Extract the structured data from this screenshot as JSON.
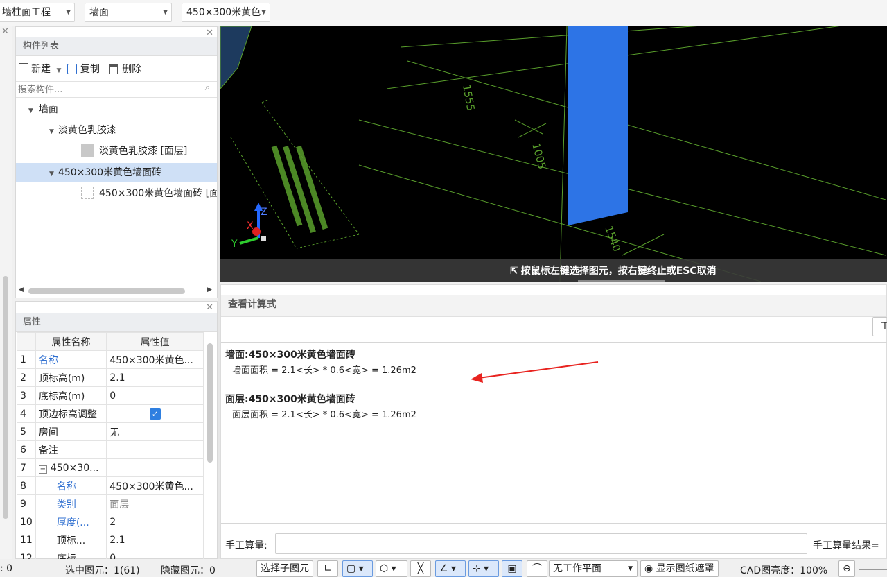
{
  "toolbar": {
    "dropdown1": "墙柱面工程",
    "dropdown2": "墙面",
    "dropdown3": "450×300米黄色"
  },
  "component_panel": {
    "title": "构件列表",
    "new_label": "新建",
    "copy_label": "复制",
    "delete_label": "删除",
    "search_placeholder": "搜索构件...",
    "tree": [
      {
        "label": "墙面"
      },
      {
        "label": "淡黄色乳胶漆"
      },
      {
        "label": "淡黄色乳胶漆 [面层]"
      },
      {
        "label": "450×300米黄色墙面砖"
      },
      {
        "label": "450×300米黄色墙面砖 [面"
      }
    ]
  },
  "props_panel": {
    "title": "属性",
    "col_name": "属性名称",
    "col_value": "属性值",
    "rows": [
      {
        "no": "1",
        "name": "名称",
        "value": "450×300米黄色..."
      },
      {
        "no": "2",
        "name": "顶标高(m)",
        "value": "2.1"
      },
      {
        "no": "3",
        "name": "底标高(m)",
        "value": "0"
      },
      {
        "no": "4",
        "name": "顶边标高调整",
        "value": ""
      },
      {
        "no": "5",
        "name": "房间",
        "value": "无"
      },
      {
        "no": "6",
        "name": "备注",
        "value": ""
      },
      {
        "no": "7",
        "name": "450×30...",
        "value": ""
      },
      {
        "no": "8",
        "name": "名称",
        "value": "450×300米黄色..."
      },
      {
        "no": "9",
        "name": "类别",
        "value": "面层"
      },
      {
        "no": "10",
        "name": "厚度(...",
        "value": "2"
      },
      {
        "no": "11",
        "name": "顶标...",
        "value": "2.1"
      },
      {
        "no": "12",
        "name": "底标...",
        "value": "0"
      }
    ]
  },
  "cad": {
    "dim1": "1555",
    "dim2": "1005",
    "dim3": "1540",
    "hint": "按鼠标左键选择图元，按右键终止或ESC取消",
    "axis_x": "X",
    "axis_y": "Y",
    "axis_z": "Z"
  },
  "calc_panel": {
    "title": "查看计算式",
    "btn_cut": "工",
    "block1_title": "墙面:450×300米黄色墙面砖",
    "block1_formula": "墙面面积 = 2.1<长> * 0.6<宽> = 1.26m2",
    "block2_title": "面层:450×300米黄色墙面砖",
    "block2_formula": "面层面积 = 2.1<长> * 0.6<宽> = 1.26m2",
    "manual_label": "手工算量:",
    "manual_result_label": "手工算量结果="
  },
  "status": {
    "left_count": ": 0",
    "selected": "选中图元：1(61)",
    "hidden": "隐藏图元：0",
    "select_child": "选择子图元",
    "no_plane": "无工作平面",
    "show_mask": "显示图纸遮罩",
    "brightness": "CAD图亮度：100%"
  },
  "colors": {
    "selected_row": "#cfe0f6",
    "wall_blue": "#2d74e6",
    "cad_line": "#5aa02c",
    "arrow_red": "#e8231f"
  }
}
